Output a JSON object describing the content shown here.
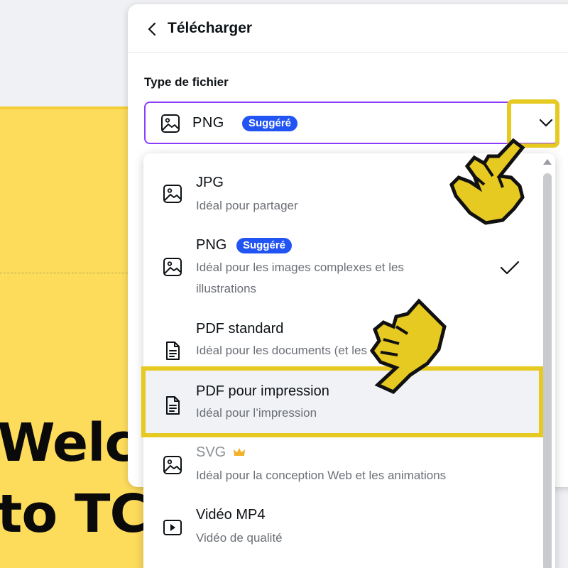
{
  "background_design": {
    "text_line1": "Welc",
    "text_line2": "to TC",
    "color": "#fddc5c"
  },
  "panel": {
    "title": "Télécharger",
    "back_icon": "chevron-left-icon",
    "file_type_label": "Type de fichier",
    "select": {
      "value": "PNG",
      "badge": "Suggéré",
      "icon": "image-icon",
      "expand_icon": "chevron-down-icon"
    }
  },
  "dropdown": {
    "options": [
      {
        "name": "JPG",
        "description": "Idéal pour partager",
        "icon": "image-icon"
      },
      {
        "name": "PNG",
        "badge": "Suggéré",
        "description": "Idéal pour les images complexes et les illustrations",
        "icon": "image-icon",
        "selected": true
      },
      {
        "name": "PDF standard",
        "description": "Idéal pour les documents (et les e-mails)",
        "icon": "document-icon"
      },
      {
        "name": "PDF pour impression",
        "description": "Idéal pour l’impression",
        "icon": "document-icon",
        "hovered": true
      },
      {
        "name": "SVG",
        "description": "Idéal pour la conception Web et les animations",
        "icon": "image-icon",
        "premium_icon": "crown-icon"
      },
      {
        "name": "Vidéo MP4",
        "description": "Vidéo de qualité",
        "icon": "video-icon"
      }
    ]
  },
  "colors": {
    "accent_purple": "#8b3dff",
    "badge_blue": "#2254f4",
    "highlight_yellow": "#e6c921",
    "crown_gold": "#f2b12a"
  }
}
